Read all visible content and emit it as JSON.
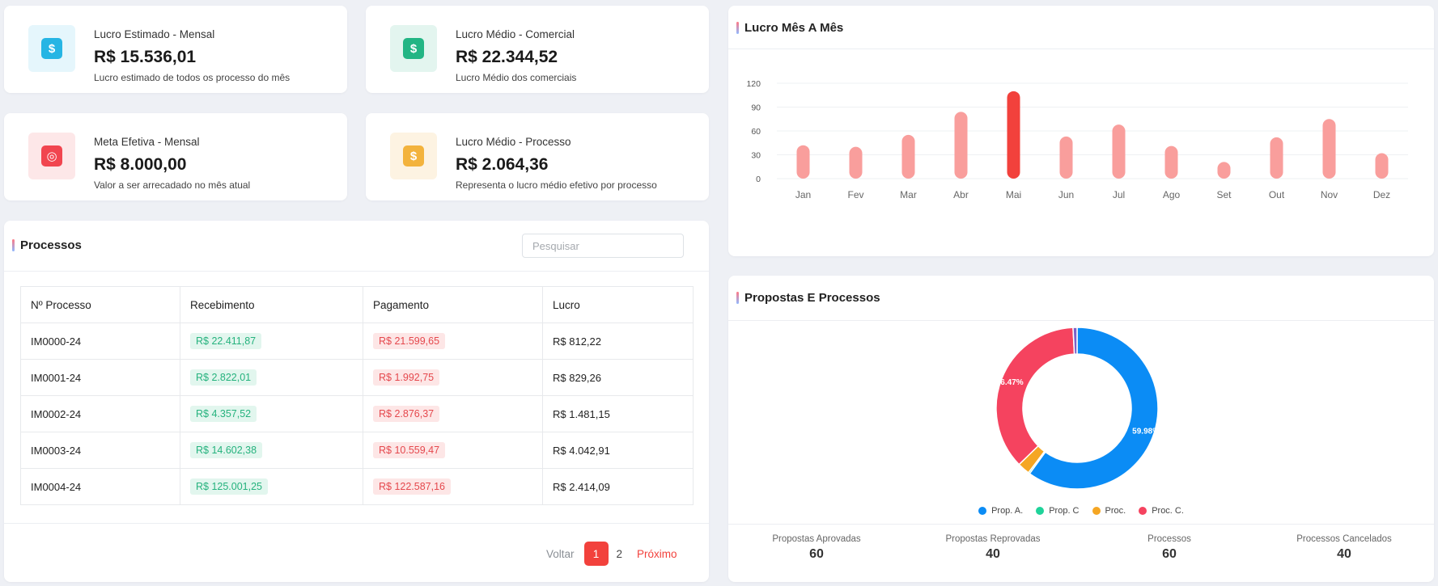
{
  "stats": [
    {
      "title": "Lucro Estimado - Mensal",
      "value": "R$ 15.536,01",
      "subtitle": "Lucro estimado de todos os processo do mês",
      "icon": "dollar-icon",
      "icon_glyph": "$",
      "icon_color": "#26b5e4",
      "icon_bg": "#e5f6fc"
    },
    {
      "title": "Lucro Médio - Comercial",
      "value": "R$ 22.344,52",
      "subtitle": "Lucro Médio dos comerciais",
      "icon": "dollar-icon",
      "icon_glyph": "$",
      "icon_color": "#23b584",
      "icon_bg": "#e3f5ef"
    },
    {
      "title": "Meta Efetiva - Mensal",
      "value": "R$ 8.000,00",
      "subtitle": "Valor a ser arrecadado no mês atual",
      "icon": "target-icon",
      "icon_glyph": "◎",
      "icon_color": "#f1454f",
      "icon_bg": "#fde7e8"
    },
    {
      "title": "Lucro Médio - Processo",
      "value": "R$ 2.064,36",
      "subtitle": "Representa o lucro médio efetivo por processo",
      "icon": "dollar-icon",
      "icon_glyph": "$",
      "icon_color": "#f3b33d",
      "icon_bg": "#fdf3e2"
    }
  ],
  "processos": {
    "title": "Processos",
    "search_placeholder": "Pesquisar",
    "columns": [
      "Nº Processo",
      "Recebimento",
      "Pagamento",
      "Lucro"
    ],
    "rows": [
      {
        "id": "IM0000-24",
        "recebimento": "R$ 22.411,87",
        "pagamento": "R$ 21.599,65",
        "lucro": "R$ 812,22"
      },
      {
        "id": "IM0001-24",
        "recebimento": "R$ 2.822,01",
        "pagamento": "R$ 1.992,75",
        "lucro": "R$ 829,26"
      },
      {
        "id": "IM0002-24",
        "recebimento": "R$ 4.357,52",
        "pagamento": "R$ 2.876,37",
        "lucro": "R$ 1.481,15"
      },
      {
        "id": "IM0003-24",
        "recebimento": "R$ 14.602,38",
        "pagamento": "R$ 10.559,47",
        "lucro": "R$ 4.042,91"
      },
      {
        "id": "IM0004-24",
        "recebimento": "R$ 125.001,25",
        "pagamento": "R$ 122.587,16",
        "lucro": "R$ 2.414,09"
      }
    ],
    "pager": {
      "prev": "Voltar",
      "pages": [
        "1",
        "2"
      ],
      "active": "1",
      "next": "Próximo"
    }
  },
  "lucro_chart": {
    "title": "Lucro Mês A Mês"
  },
  "propostas": {
    "title": "Propostas E Processos",
    "summary": [
      {
        "label": "Propostas Aprovadas",
        "value": "60"
      },
      {
        "label": "Propostas Reprovadas",
        "value": "40"
      },
      {
        "label": "Processos",
        "value": "60"
      },
      {
        "label": "Processos Cancelados",
        "value": "40"
      }
    ]
  },
  "chart_data": [
    {
      "type": "bar",
      "title": "Lucro Mês A Mês",
      "categories": [
        "Jan",
        "Fev",
        "Mar",
        "Abr",
        "Mai",
        "Jun",
        "Jul",
        "Ago",
        "Set",
        "Out",
        "Nov",
        "Dez"
      ],
      "values": [
        42,
        40,
        55,
        84,
        110,
        53,
        68,
        41,
        21,
        52,
        75,
        32
      ],
      "highlight_index": 4,
      "ylim": [
        0,
        120
      ],
      "yticks": [
        0,
        30,
        60,
        90,
        120
      ],
      "colors": {
        "bar": "#f99e9c",
        "highlight": "#f2413c"
      },
      "grid": true
    },
    {
      "type": "pie",
      "labels": [
        "Prop. A.",
        "Prop. C",
        "Proc.",
        "Proc. C."
      ],
      "values": [
        59.98,
        0.3,
        2.45,
        36.47
      ],
      "extra_slice": {
        "value": 0.8,
        "color": "#7b61c9"
      },
      "shown_labels": [
        "59.98%",
        "36.47%"
      ],
      "colors": [
        "#0b8cf5",
        "#1fd39a",
        "#f5a623",
        "#f5435f"
      ],
      "legend_position": "bottom"
    }
  ]
}
